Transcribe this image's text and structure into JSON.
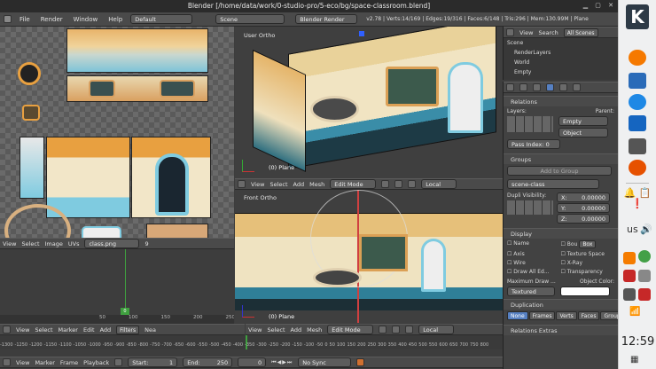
{
  "window": {
    "title": "Blender [/home/data/work/0-studio-pro/5-eco/bg/space-classroom.blend]"
  },
  "infobar": {
    "menus": [
      "File",
      "Render",
      "Window",
      "Help"
    ],
    "layout": "Default",
    "scene": "Scene",
    "engine": "Blender Render",
    "stats": "v2.78 | Verts:14/169 | Edges:19/316 | Faces:6/148 | Tris:296 | Mem:130.99M | Plane"
  },
  "uv_editor": {
    "menus": [
      "View",
      "Select",
      "Image",
      "UVs"
    ],
    "image_name": "class.png",
    "users": "9",
    "ruler": [
      "0",
      "50",
      "100",
      "150",
      "200",
      "250"
    ]
  },
  "viewport_top": {
    "label": "User Ortho",
    "object": "(0) Plane"
  },
  "viewport_bottom": {
    "label": "Front Ortho",
    "object": "(0) Plane"
  },
  "view3d_header": {
    "menus": [
      "View",
      "Select",
      "Add",
      "Mesh"
    ],
    "mode": "Edit Mode",
    "pivot": "Local"
  },
  "graph_header": {
    "menus": [
      "View",
      "Select",
      "Marker",
      "Edit",
      "Add"
    ],
    "filters": "Filters",
    "extra": "Nea"
  },
  "timeline": {
    "menus": [
      "View",
      "Marker",
      "Frame",
      "Playback"
    ],
    "start": "Start:",
    "start_val": "1",
    "end": "End:",
    "end_val": "250",
    "current": "0",
    "sync": "No Sync",
    "ruler": [
      "-1300",
      "-1250",
      "-1200",
      "-1150",
      "-1100",
      "-1050",
      "-1000",
      "-950",
      "-900",
      "-850",
      "-800",
      "-750",
      "-700",
      "-650",
      "-600",
      "-550",
      "-500",
      "-450",
      "-400",
      "-350",
      "-300",
      "-250",
      "-200",
      "-150",
      "-100",
      "-50",
      "0",
      "50",
      "100",
      "150",
      "200",
      "250",
      "300",
      "350",
      "400",
      "450",
      "500",
      "550",
      "600",
      "650",
      "700",
      "750",
      "800"
    ]
  },
  "outliner": {
    "menus": [
      "View",
      "Search",
      "All Scenes"
    ],
    "items": [
      "Scene",
      "RenderLayers",
      "World",
      "Empty"
    ]
  },
  "properties": {
    "relations": "Relations",
    "layers_label": "Layers:",
    "parent_label": "Parent:",
    "parent_value": "Empty",
    "parent_type": "Object",
    "pass_index": "Pass Index: 0",
    "groups": "Groups",
    "add_to_group": "Add to Group",
    "group_name": "scene-class",
    "dupli_vis": "Dupli Visibility:",
    "x": "X:",
    "y": "Y:",
    "z": "Z:",
    "xv": "0.00000",
    "yv": "0.00000",
    "zv": "0.00000",
    "display": "Display",
    "name": "Name",
    "bounds": "Bou",
    "bounds_type": "Box",
    "axis": "Axis",
    "texture_space": "Texture Space",
    "wire": "Wire",
    "xray": "X-Ray",
    "draw_all": "Draw All Ed...",
    "transparency": "Transparency",
    "max_draw": "Maximum Draw ...",
    "obj_color": "Object Color:",
    "textured": "Textured",
    "duplication": "Duplication",
    "dup_opts": [
      "None",
      "Frames",
      "Verts",
      "Faces",
      "Group"
    ],
    "relations_extras": "Relations Extras"
  },
  "kde": {
    "lang": "us",
    "clock": "12:59"
  },
  "colors": {
    "accent": "#5680c2",
    "kde_bg": "#eff0f1"
  }
}
